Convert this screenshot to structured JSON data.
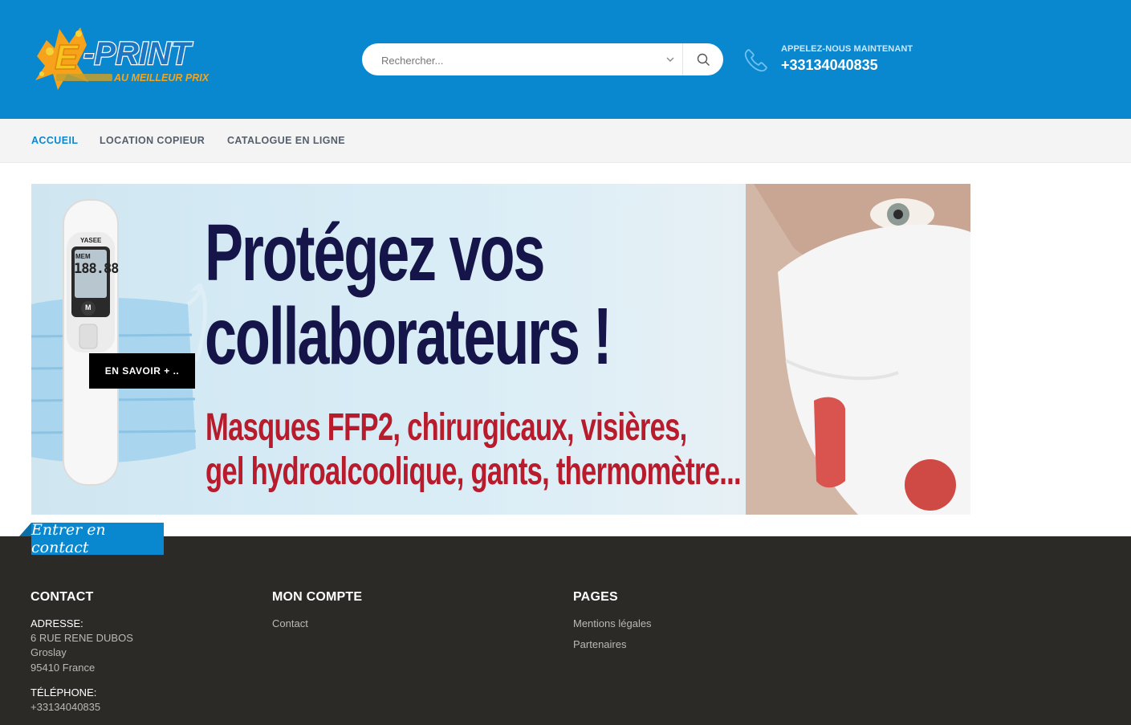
{
  "header": {
    "logo": {
      "name": "E-PRINT",
      "tagline": "AU MEILLEUR PRIX"
    },
    "search": {
      "placeholder": "Rechercher..."
    },
    "call": {
      "label": "APPELEZ-NOUS MAINTENANT",
      "number": "+33134040835"
    },
    "colors": {
      "brand_blue": "#0a88cf"
    }
  },
  "nav": {
    "items": [
      {
        "label": "ACCUEIL",
        "active": true
      },
      {
        "label": "LOCATION COPIEUR",
        "active": false
      },
      {
        "label": "CATALOGUE EN LIGNE",
        "active": false
      }
    ]
  },
  "banner": {
    "headline_1": "Protégez vos",
    "headline_2": "collaborateurs !",
    "subline_1": "Masques FFP2, chirurgicaux, visières,",
    "subline_2": "gel hydroalcoolique, gants, thermomètre...",
    "cta": "EN SAVOIR + ..",
    "thermometer": {
      "brand": "YASEE",
      "mem": "MEM",
      "reading": "188.88",
      "button": "M"
    }
  },
  "footer": {
    "contact_tab": "Entrer en contact",
    "contact": {
      "title": "CONTACT",
      "address_label": "ADRESSE:",
      "address_line_1": "6 RUE RENE DUBOS",
      "address_line_2": "Groslay",
      "address_line_3": "95410 France",
      "phone_label": "TÉLÉPHONE:",
      "phone": "+33134040835"
    },
    "account": {
      "title": "MON COMPTE",
      "links": [
        "Contact"
      ]
    },
    "pages": {
      "title": "PAGES",
      "links": [
        "Mentions légales",
        "Partenaires"
      ]
    }
  }
}
